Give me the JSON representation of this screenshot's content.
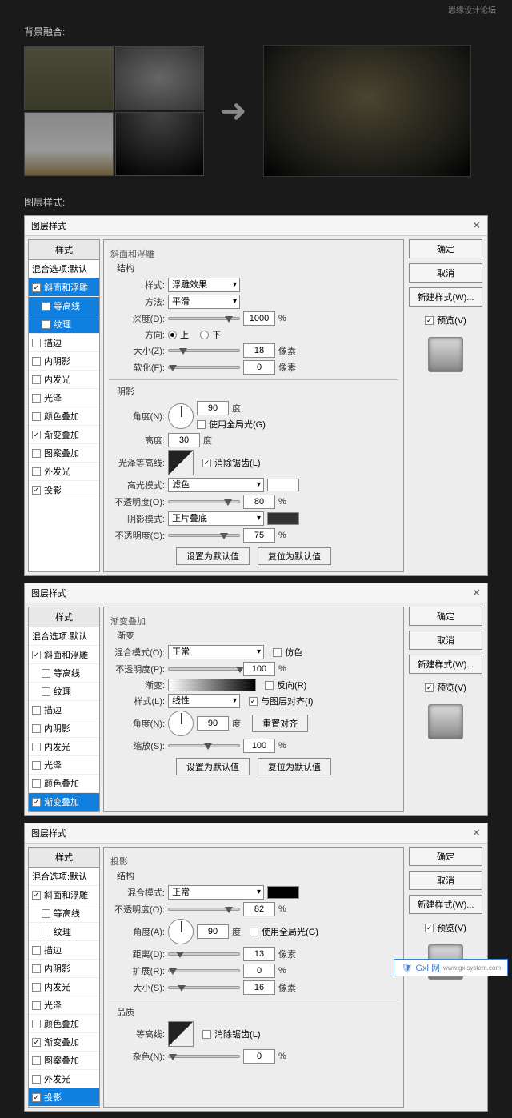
{
  "watermark": "思缘设计论坛",
  "labels": {
    "blend": "背景融合:",
    "layerStyle": "图层样式:"
  },
  "dialog": {
    "title": "图层样式",
    "buttons": {
      "ok": "确定",
      "cancel": "取消",
      "newStyle": "新建样式(W)...",
      "preview": "预览(V)",
      "reset": "设置为默认值",
      "restore": "复位为默认值",
      "resetAlign": "重置对齐"
    }
  },
  "styleList": {
    "header": "样式",
    "blendOpts": "混合选项:默认",
    "items": [
      "斜面和浮雕",
      "等高线",
      "纹理",
      "描边",
      "内阴影",
      "内发光",
      "光泽",
      "颜色叠加",
      "渐变叠加",
      "图案叠加",
      "外发光",
      "投影"
    ]
  },
  "bevel": {
    "title": "斜面和浮雕",
    "structure": "结构",
    "shadow": "阴影",
    "styleL": "样式:",
    "styleV": "浮雕效果",
    "methodL": "方法:",
    "methodV": "平滑",
    "depthL": "深度(D):",
    "depthV": "1000",
    "sizeL": "大小(Z):",
    "sizeV": "18",
    "softenL": "软化(F):",
    "softenV": "0",
    "dirL": "方向:",
    "up": "上",
    "down": "下",
    "angleL": "角度(N):",
    "angleV": "90",
    "globalL": "使用全局光(G)",
    "altL": "高度:",
    "altV": "30",
    "glossL": "光泽等高线:",
    "antiL": "消除锯齿(L)",
    "hiModeL": "高光模式:",
    "hiModeV": "滤色",
    "hiOpL": "不透明度(O):",
    "hiOpV": "80",
    "shModeL": "阴影模式:",
    "shModeV": "正片叠底",
    "shOpL": "不透明度(C):",
    "shOpV": "75",
    "px": "像素",
    "deg": "度",
    "pct": "%"
  },
  "grad": {
    "title": "渐变叠加",
    "sub": "渐变",
    "blendL": "混合模式(O):",
    "blendV": "正常",
    "ditherL": "仿色",
    "opL": "不透明度(P):",
    "opV": "100",
    "gradL": "渐变:",
    "revL": "反向(R)",
    "styleL": "样式(L):",
    "styleV": "线性",
    "alignL": "与图层对齐(I)",
    "angleL": "角度(N):",
    "angleV": "90",
    "scaleL": "缩放(S):",
    "scaleV": "100"
  },
  "shadow": {
    "title": "投影",
    "structure": "结构",
    "quality": "品质",
    "blendL": "混合模式:",
    "blendV": "正常",
    "opL": "不透明度(O):",
    "opV": "82",
    "angleL": "角度(A):",
    "angleV": "90",
    "globalL": "使用全局光(G)",
    "distL": "距离(D):",
    "distV": "13",
    "spreadL": "扩展(R):",
    "spreadV": "0",
    "sizeL": "大小(S):",
    "sizeV": "16",
    "contourL": "等高线:",
    "antiL": "消除锯齿(L)",
    "noiseL": "杂色(N):",
    "noiseV": "0"
  },
  "footer": {
    "brand": "Gxl 网",
    "url": "www.gxlsystem.com"
  }
}
